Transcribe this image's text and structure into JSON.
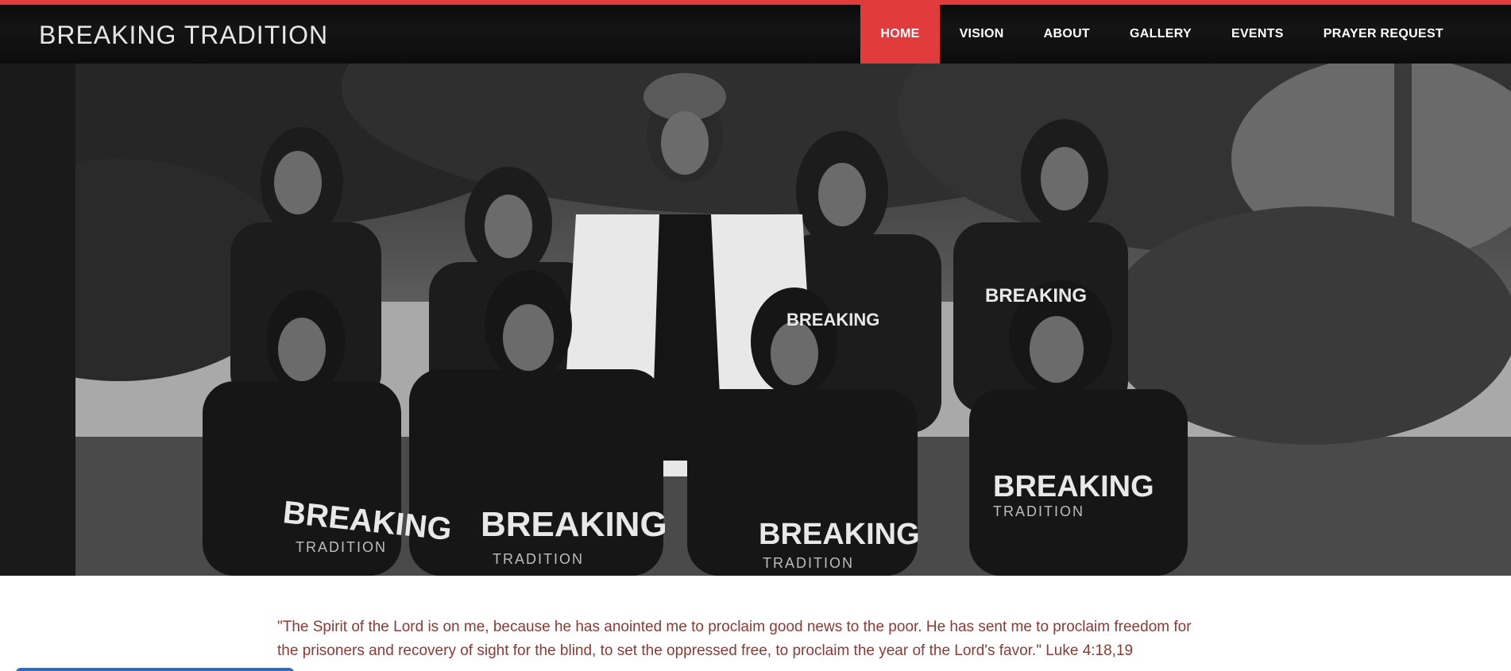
{
  "header": {
    "brand": "BREAKING TRADITION",
    "accent_color": "#e23b3d",
    "background_color": "#111111"
  },
  "nav": {
    "items": [
      {
        "label": "HOME",
        "active": true
      },
      {
        "label": "VISION",
        "active": false
      },
      {
        "label": "ABOUT",
        "active": false
      },
      {
        "label": "GALLERY",
        "active": false
      },
      {
        "label": "EVENTS",
        "active": false
      },
      {
        "label": "PRAYER REQUEST",
        "active": false
      }
    ]
  },
  "hero": {
    "tshirt_text_top": "BREAKING",
    "tshirt_text_bottom": "TRADITION"
  },
  "main": {
    "quote_line1": "\"The Spirit of the Lord is on me, because he has anointed me to proclaim good news to the poor.  He has sent me to proclaim freedom for",
    "quote_line2": "the prisoners and recovery of sight for the blind, to set the oppressed free, to proclaim the year of the Lord's favor.\" Luke 4:18,19",
    "quote_color": "#8b3a36"
  }
}
